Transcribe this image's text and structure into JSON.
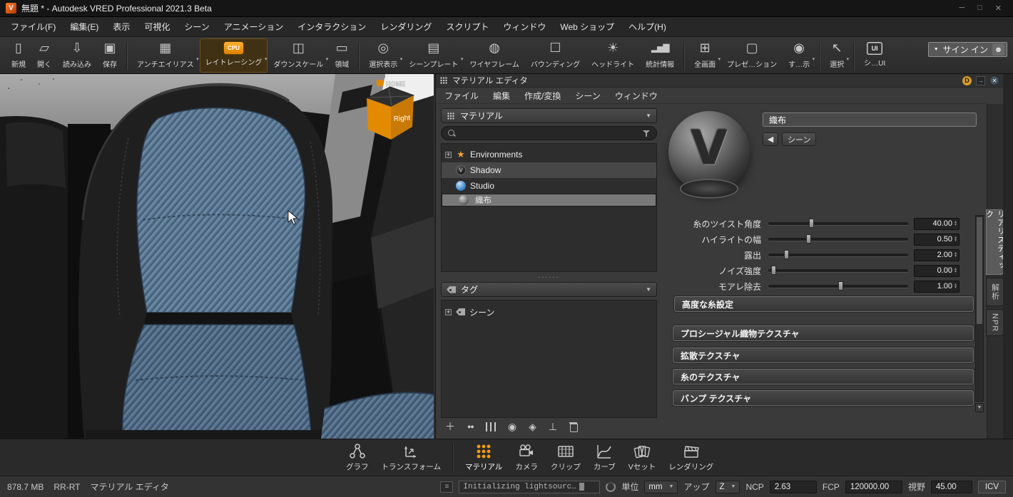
{
  "colors": {
    "accent": "#f59c07",
    "denim": "#54718c",
    "panel_bg": "#3a3a3a",
    "selection": "#787878"
  },
  "window": {
    "logo": "V",
    "title": "無題 * - Autodesk VRED Professional 2021.3 Beta",
    "controls": {
      "minimize": "─",
      "maximize": "□",
      "close": "✕"
    }
  },
  "menubar": {
    "items": [
      "ファイル(F)",
      "編集(E)",
      "表示",
      "可視化",
      "シーン",
      "アニメーション",
      "インタラクション",
      "レンダリング",
      "スクリプト",
      "ウィンドウ",
      "Web ショップ",
      "ヘルプ(H)"
    ]
  },
  "toolbar": {
    "buttons": [
      {
        "icon": "new-file-icon",
        "label": "新規"
      },
      {
        "icon": "open-folder-icon",
        "label": "開く"
      },
      {
        "icon": "import-icon",
        "label": "読み込み"
      },
      {
        "icon": "save-icon",
        "label": "保存"
      },
      {
        "icon": "antialias-icon",
        "label": "アンチエイリアス",
        "dropdown": true
      },
      {
        "icon": "raytracing-cpu-icon",
        "chip": "CPU",
        "label": "レイトレーシング",
        "dropdown": true,
        "active": true
      },
      {
        "icon": "downscale-icon",
        "label": "ダウンスケール",
        "dropdown": true
      },
      {
        "icon": "region-icon",
        "label": "領域"
      },
      {
        "icon": "isolate-view-icon",
        "label": "選択表示",
        "dropdown": true
      },
      {
        "icon": "sceneplate-icon",
        "label": "シーンプレート",
        "dropdown": true
      },
      {
        "icon": "wireframe-icon",
        "label": "ワイヤフレーム"
      },
      {
        "icon": "bounding-box-icon",
        "label": "バウンディング"
      },
      {
        "icon": "headlight-icon",
        "label": "ヘッドライト"
      },
      {
        "icon": "statistics-icon",
        "label": "統計情報"
      },
      {
        "icon": "fullscreen-icon",
        "label": "全画面",
        "dropdown": true
      },
      {
        "icon": "presentation-icon",
        "label": "プレゼ…ション"
      },
      {
        "icon": "display-icon",
        "label": "す…示",
        "dropdown": true
      },
      {
        "icon": "select-icon",
        "label": "選択",
        "dropdown": true
      },
      {
        "icon": "ui-icon",
        "chip": "UI",
        "label": "シ…UI"
      }
    ],
    "sign_in": {
      "label": "サイン イン"
    }
  },
  "viewport": {
    "nav_cube": {
      "home_label": "HOME",
      "face_label": "Right"
    }
  },
  "material_editor": {
    "title": "マテリアル エディタ",
    "header": {
      "badge": "D",
      "float": "→",
      "close": "✕"
    },
    "menu": [
      "ファイル",
      "編集",
      "作成/変換",
      "シーン",
      "ウィンドウ"
    ],
    "type_selector": "マテリアル",
    "search_value": "",
    "tree": [
      {
        "icon": "environments-icon",
        "label": "Environments"
      },
      {
        "icon": "shadow-material-icon",
        "label": "Shadow"
      },
      {
        "icon": "studio-material-icon",
        "label": "Studio"
      },
      {
        "icon": "fabric-material-icon",
        "label": "織布",
        "selected": true
      }
    ],
    "tag_selector": "タグ",
    "tag_tree": [
      {
        "icon": "tag-icon",
        "label": "シーン"
      }
    ],
    "preview_name": "織布",
    "scene_button": "シーン",
    "sliders": [
      {
        "label": "糸のツイスト角度",
        "value": "40.00",
        "pos": "29%"
      },
      {
        "label": "ハイライトの幅",
        "value": "0.50",
        "pos": "27%"
      },
      {
        "label": "露出",
        "value": "2.00",
        "pos": "11%"
      },
      {
        "label": "ノイズ強度",
        "value": "0.00",
        "pos": "2%"
      },
      {
        "label": "モアレ除去",
        "value": "1.00",
        "pos": "50%"
      }
    ],
    "advanced_button": "高度な糸設定",
    "sections": [
      "プロシージャル織物テクスチャ",
      "拡散テクスチャ",
      "糸のテクスチャ",
      "バンプ テクスチャ"
    ],
    "side_tabs": [
      {
        "label": "リアリスティック",
        "active": true
      },
      {
        "label": "解析"
      },
      {
        "label": "NPR"
      }
    ]
  },
  "modulebar": {
    "items": [
      {
        "icon": "graph-icon",
        "label": "グラフ"
      },
      {
        "icon": "transform-icon",
        "label": "トランスフォーム"
      },
      {
        "icon": "material-icon",
        "label": "マテリアル",
        "active": true
      },
      {
        "icon": "camera-icon",
        "label": "カメラ"
      },
      {
        "icon": "clip-icon",
        "label": "クリップ"
      },
      {
        "icon": "curve-icon",
        "label": "カーブ"
      },
      {
        "icon": "vset-icon",
        "label": "Vセット"
      },
      {
        "icon": "render-icon",
        "label": "レンダリング"
      }
    ]
  },
  "statusbar": {
    "memory": "878.7 MB",
    "mode": "RR-RT",
    "context": "マテリアル エディタ",
    "message": "Initializing lightsourc…",
    "unit_label": "単位",
    "unit_value": "mm",
    "up_label": "アップ",
    "up_value": "Z",
    "ncp_label": "NCP",
    "ncp_value": "2.63",
    "fcp_label": "FCP",
    "fcp_value": "120000.00",
    "fov_label": "視野",
    "fov_value": "45.00",
    "icv_label": "ICV"
  }
}
